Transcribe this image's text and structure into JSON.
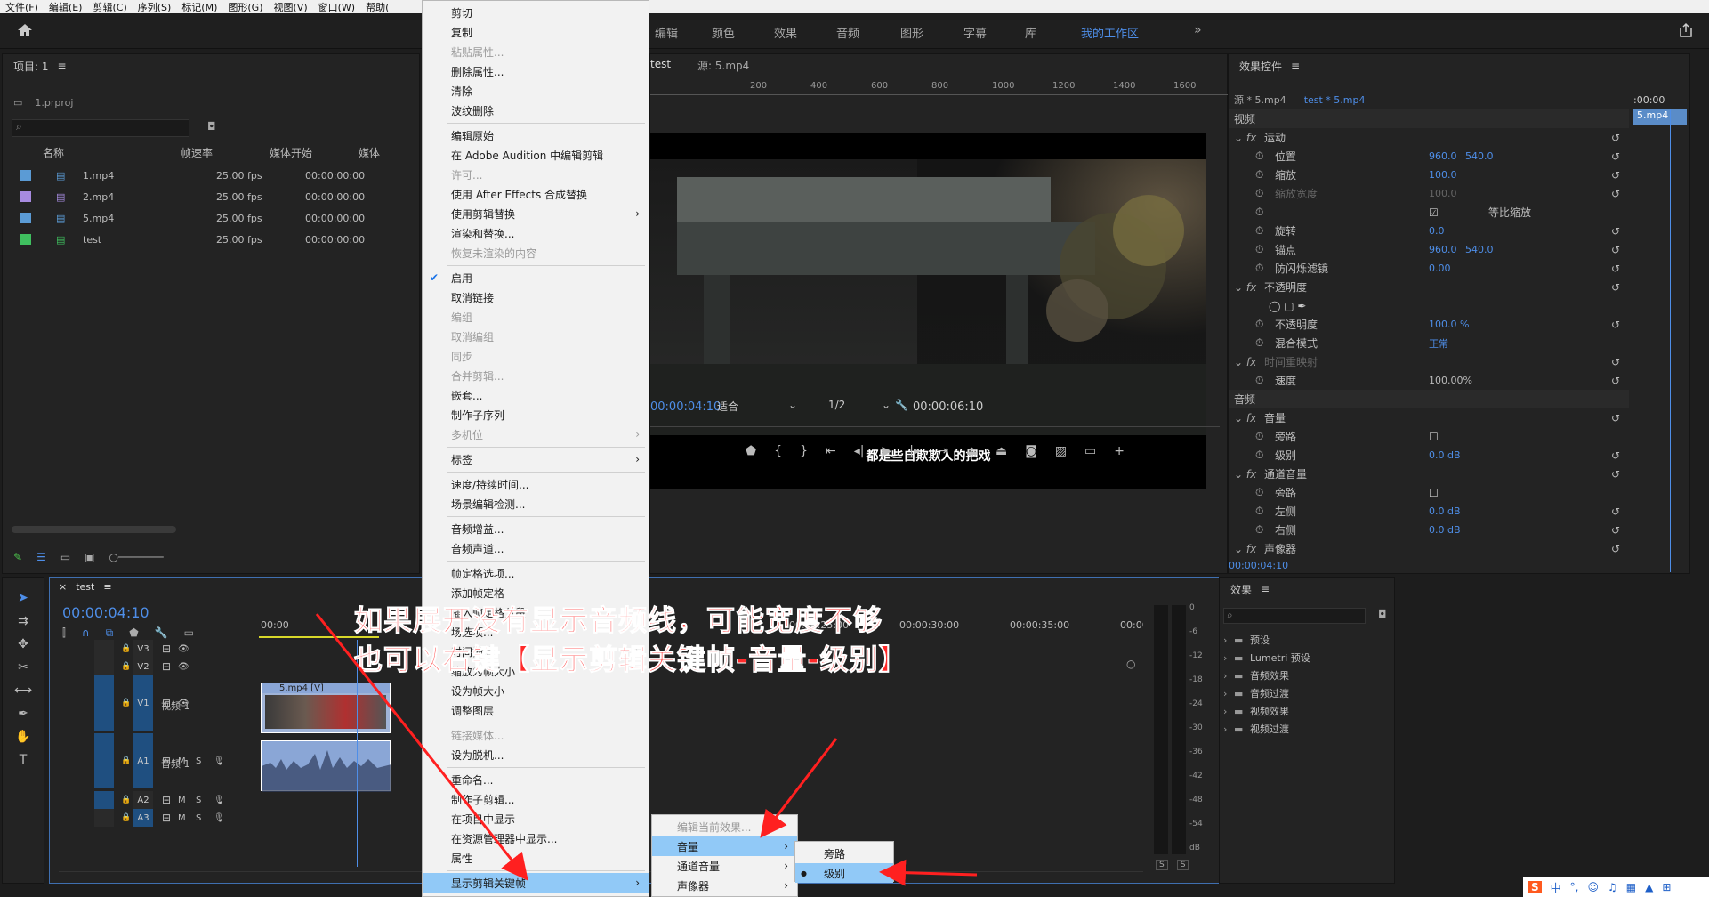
{
  "menubar": [
    "文件(F)",
    "编辑(E)",
    "剪辑(C)",
    "序列(S)",
    "标记(M)",
    "图形(G)",
    "视图(V)",
    "窗口(W)",
    "帮助("
  ],
  "workspace_tabs": [
    "编辑",
    "颜色",
    "效果",
    "音频",
    "图形",
    "字幕",
    "库",
    "我的工作区"
  ],
  "project": {
    "title": "项目: 1",
    "file": "1.prproj",
    "columns": [
      "名称",
      "帧速率",
      "媒体开始",
      "媒体"
    ],
    "items": [
      {
        "name": "1.mp4",
        "fps": "25.00 fps",
        "start": "00:00:00:00",
        "color": "#5b9bd5"
      },
      {
        "name": "2.mp4",
        "fps": "25.00 fps",
        "start": "00:00:00:00",
        "color": "#a78be0"
      },
      {
        "name": "5.mp4",
        "fps": "25.00 fps",
        "start": "00:00:00:00",
        "color": "#5b9bd5"
      },
      {
        "name": "test",
        "fps": "25.00 fps",
        "start": "00:00:00:00",
        "color": "#3fbf5f"
      }
    ]
  },
  "program": {
    "tab": "test",
    "source": "源: 5.mp4",
    "ruler": [
      "200",
      "400",
      "600",
      "800",
      "1000",
      "1200",
      "1400",
      "1600",
      "1800"
    ],
    "subtitle": "都是些自欺欺人的把戏",
    "timecode": "00:00:04:10",
    "fit": "适合",
    "res": "1/2",
    "duration": "00:00:06:10"
  },
  "context_menu": [
    {
      "label": "剪切",
      "dis": false
    },
    {
      "label": "复制",
      "dis": false
    },
    {
      "label": "粘贴属性...",
      "dis": true
    },
    {
      "label": "删除属性...",
      "dis": false
    },
    {
      "label": "清除",
      "dis": false
    },
    {
      "label": "波纹删除",
      "dis": false
    },
    {
      "label": "编辑原始",
      "dis": false,
      "sep": true
    },
    {
      "label": "在 Adobe Audition 中编辑剪辑",
      "dis": false
    },
    {
      "label": "许可...",
      "dis": true
    },
    {
      "label": "使用 After Effects 合成替换",
      "dis": false
    },
    {
      "label": "使用剪辑替换",
      "dis": false,
      "sub": true
    },
    {
      "label": "渲染和替换...",
      "dis": false
    },
    {
      "label": "恢复未渲染的内容",
      "dis": true
    },
    {
      "label": "启用",
      "dis": false,
      "sep": true,
      "check": true
    },
    {
      "label": "取消链接",
      "dis": false
    },
    {
      "label": "编组",
      "dis": true
    },
    {
      "label": "取消编组",
      "dis": true
    },
    {
      "label": "同步",
      "dis": true
    },
    {
      "label": "合并剪辑...",
      "dis": true
    },
    {
      "label": "嵌套...",
      "dis": false
    },
    {
      "label": "制作子序列",
      "dis": false
    },
    {
      "label": "多机位",
      "dis": true,
      "sub": true
    },
    {
      "label": "标签",
      "dis": false,
      "sep": true,
      "sub": true
    },
    {
      "label": "速度/持续时间...",
      "dis": false,
      "sep": true
    },
    {
      "label": "场景编辑检测...",
      "dis": false
    },
    {
      "label": "音频增益...",
      "dis": false,
      "sep": true
    },
    {
      "label": "音频声道...",
      "dis": false
    },
    {
      "label": "帧定格选项...",
      "dis": false,
      "sep": true
    },
    {
      "label": "添加帧定格",
      "dis": false
    },
    {
      "label": "插入帧定格分段",
      "dis": false
    },
    {
      "label": "场选项...",
      "dis": false
    },
    {
      "label": "时间插值",
      "dis": false,
      "sub": true
    },
    {
      "label": "缩放为帧大小",
      "dis": false
    },
    {
      "label": "设为帧大小",
      "dis": false
    },
    {
      "label": "调整图层",
      "dis": false
    },
    {
      "label": "链接媒体...",
      "dis": true,
      "sep": true
    },
    {
      "label": "设为脱机...",
      "dis": false
    },
    {
      "label": "重命名...",
      "dis": false,
      "sep": true
    },
    {
      "label": "制作子剪辑...",
      "dis": false
    },
    {
      "label": "在项目中显示",
      "dis": false
    },
    {
      "label": "在资源管理器中显示...",
      "dis": false
    },
    {
      "label": "属性",
      "dis": false
    },
    {
      "label": "显示剪辑关键帧",
      "dis": false,
      "sep": true,
      "sub": true,
      "hl": true
    }
  ],
  "submenu1": [
    {
      "label": "编辑当前效果...",
      "dis": true
    },
    {
      "label": "音量",
      "sub": true,
      "hl": true
    },
    {
      "label": "通道音量",
      "sub": true
    },
    {
      "label": "声像器",
      "sub": true
    }
  ],
  "submenu2": [
    {
      "label": "旁路"
    },
    {
      "label": "级别",
      "hl": true,
      "dot": true
    }
  ],
  "effect_controls": {
    "title": "效果控件",
    "source": "源 * 5.mp4",
    "seq": "test * 5.mp4",
    "clip": "5.mp4",
    "time": ":00:00",
    "current": "00:00:04:10",
    "rows": [
      {
        "label": "视频",
        "kind": "section"
      },
      {
        "label": "运动",
        "kind": "fx"
      },
      {
        "label": "位置",
        "v1": "960.0",
        "v2": "540.0"
      },
      {
        "label": "缩放",
        "v1": "100.0"
      },
      {
        "label": "缩放宽度",
        "v1": "100.0",
        "dim": true
      },
      {
        "label": "等比缩放",
        "kind": "check"
      },
      {
        "label": "旋转",
        "v1": "0.0"
      },
      {
        "label": "锚点",
        "v1": "960.0",
        "v2": "540.0"
      },
      {
        "label": "防闪烁滤镜",
        "v1": "0.00"
      },
      {
        "label": "不透明度",
        "kind": "fx"
      },
      {
        "label": "",
        "kind": "masks"
      },
      {
        "label": "不透明度",
        "v1": "100.0 %"
      },
      {
        "label": "混合模式",
        "kind": "select",
        "v1": "正常"
      },
      {
        "label": "时间重映射",
        "kind": "fx",
        "dim": true
      },
      {
        "label": "速度",
        "v1": "100.00%",
        "white": true
      },
      {
        "label": "音频",
        "kind": "section"
      },
      {
        "label": "音量",
        "kind": "fx"
      },
      {
        "label": "旁路",
        "kind": "box"
      },
      {
        "label": "级别",
        "v1": "0.0 dB"
      },
      {
        "label": "通道音量",
        "kind": "fx"
      },
      {
        "label": "旁路",
        "kind": "box"
      },
      {
        "label": "左侧",
        "v1": "0.0 dB"
      },
      {
        "label": "右侧",
        "v1": "0.0 dB"
      },
      {
        "label": "声像器",
        "kind": "fx"
      }
    ]
  },
  "timeline": {
    "tab": "test",
    "timecode": "00:00:04:10",
    "ruler": [
      "00:00",
      "00:00:25:00",
      "00:00:30:00",
      "00:00:35:00",
      "00:00:40:00"
    ],
    "tracks": [
      "V3",
      "V2",
      "V1",
      "A1",
      "A2",
      "A3"
    ],
    "v1_name": "视频 1",
    "a1_name": "音频 1",
    "clip": "5.mp4 [V]"
  },
  "meter": {
    "labels": [
      "0",
      "-6",
      "-12",
      "-18",
      "-24",
      "-30",
      "-36",
      "-42",
      "-48",
      "-54",
      "dB"
    ],
    "solo": [
      "S",
      "S"
    ]
  },
  "effects": {
    "title": "效果",
    "items": [
      "预设",
      "Lumetri 预设",
      "音频效果",
      "音频过渡",
      "视频效果",
      "视频过渡"
    ]
  },
  "annotation": {
    "line1": "如果展开没有显示音频线，可能宽度不够",
    "line2": "也可以右键【显示剪辑关键帧-音量-级别】"
  },
  "tray": {
    "ime": "中"
  }
}
